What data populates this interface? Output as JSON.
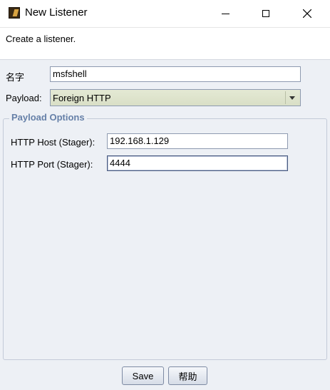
{
  "window": {
    "title": "New Listener",
    "icon": "armitage-app-icon"
  },
  "description": "Create a listener.",
  "form": {
    "name_label": "名字",
    "name_value": "msfshell",
    "payload_label": "Payload:",
    "payload_value": "Foreign HTTP"
  },
  "payload_options": {
    "title": "Payload Options",
    "host_label": "HTTP Host (Stager):",
    "host_value": "192.168.1.129",
    "port_label": "HTTP Port (Stager):",
    "port_value": "4444"
  },
  "buttons": {
    "save": "Save",
    "help": "帮助"
  },
  "colors": {
    "panel_bg": "#edf0f5",
    "group_title": "#6680a8",
    "combo_bg": "#dfe4cc"
  }
}
